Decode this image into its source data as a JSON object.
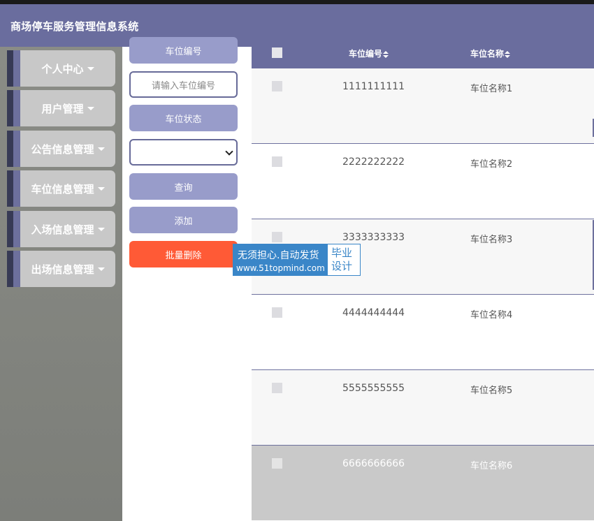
{
  "header": {
    "title": "商场停车服务管理信息系统"
  },
  "sidebar": {
    "items": [
      {
        "label": "个人中心"
      },
      {
        "label": "用户管理"
      },
      {
        "label": "公告信息管理"
      },
      {
        "label": "车位信息管理"
      },
      {
        "label": "入场信息管理"
      },
      {
        "label": "出场信息管理"
      }
    ]
  },
  "search": {
    "code_label": "车位编号",
    "code_placeholder": "请输入车位编号",
    "status_label": "车位状态",
    "status_selected": "",
    "query_button": "查询",
    "add_button": "添加",
    "batch_delete_button": "批量删除"
  },
  "watermark": {
    "line1": "无须担心.自动发货",
    "line2": "www.51topmind.com",
    "right": "毕业设计"
  },
  "table": {
    "columns": [
      {
        "label": "车位编号"
      },
      {
        "label": "车位名称"
      }
    ],
    "rows": [
      {
        "code": "1111111111",
        "name": "车位名称1"
      },
      {
        "code": "2222222222",
        "name": "车位名称2"
      },
      {
        "code": "3333333333",
        "name": "车位名称3"
      },
      {
        "code": "4444444444",
        "name": "车位名称4"
      },
      {
        "code": "5555555555",
        "name": "车位名称5"
      },
      {
        "code": "6666666666",
        "name": "车位名称6"
      }
    ]
  },
  "colors": {
    "header": "#6a6d9e",
    "lavender_button": "#989cca",
    "danger_button": "#ff5a36",
    "sidebar_item": "#c8c8c8"
  }
}
